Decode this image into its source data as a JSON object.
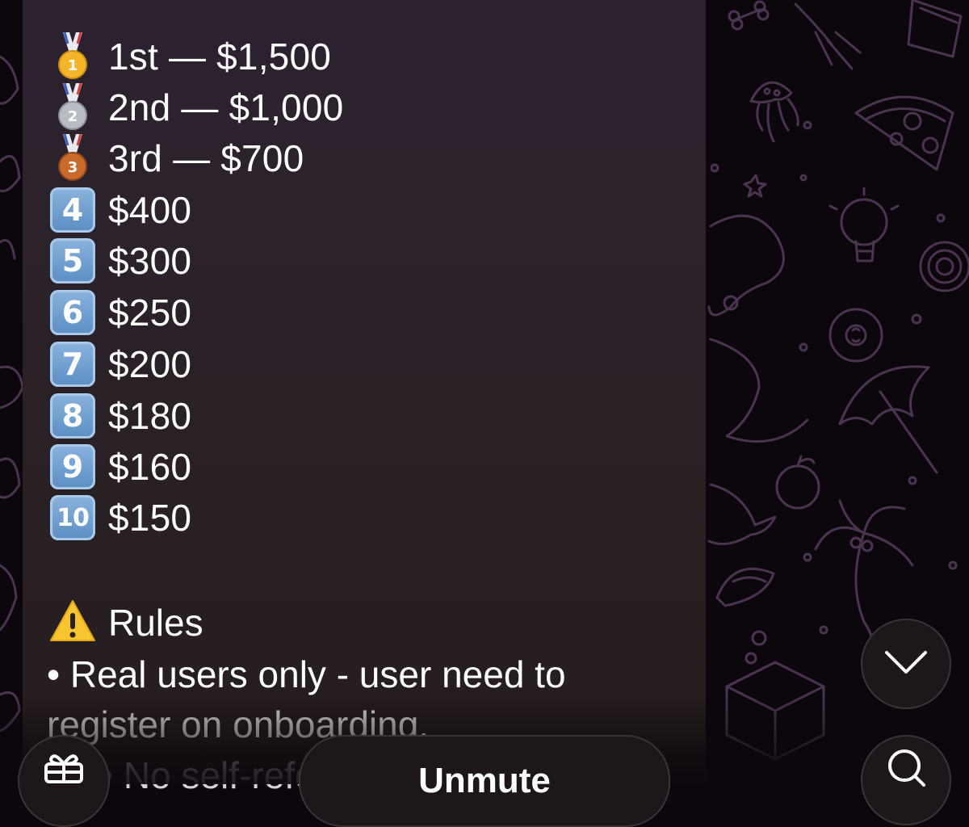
{
  "prizes": [
    {
      "icon": "gold-medal-icon",
      "text": "1st — $1,500"
    },
    {
      "icon": "silver-medal-icon",
      "text": "2nd — $1,000"
    },
    {
      "icon": "bronze-medal-icon",
      "text": "3rd — $700"
    },
    {
      "icon": "keycap-4-icon",
      "key": "4",
      "text": "$400"
    },
    {
      "icon": "keycap-5-icon",
      "key": "5",
      "text": "$300"
    },
    {
      "icon": "keycap-6-icon",
      "key": "6",
      "text": "$250"
    },
    {
      "icon": "keycap-7-icon",
      "key": "7",
      "text": "$200"
    },
    {
      "icon": "keycap-8-icon",
      "key": "8",
      "text": "$180"
    },
    {
      "icon": "keycap-9-icon",
      "key": "9",
      "text": "$160"
    },
    {
      "icon": "keycap-10-icon",
      "key": "10",
      "text": "$150"
    }
  ],
  "rules": {
    "heading_icon": "warning-icon",
    "heading": "Rules",
    "line1": "• Real users only - user need to",
    "line2": "register on onboarding.",
    "line3": "• No self-referr"
  },
  "controls": {
    "gift_icon": "gift-icon",
    "unmute_label": "Unmute",
    "scroll_down_icon": "chevron-down-icon",
    "search_icon": "search-icon"
  },
  "colors": {
    "bubble": "#2a2126",
    "keycap": "#6d9bcd",
    "wallpaper_line": "#4a3450"
  }
}
